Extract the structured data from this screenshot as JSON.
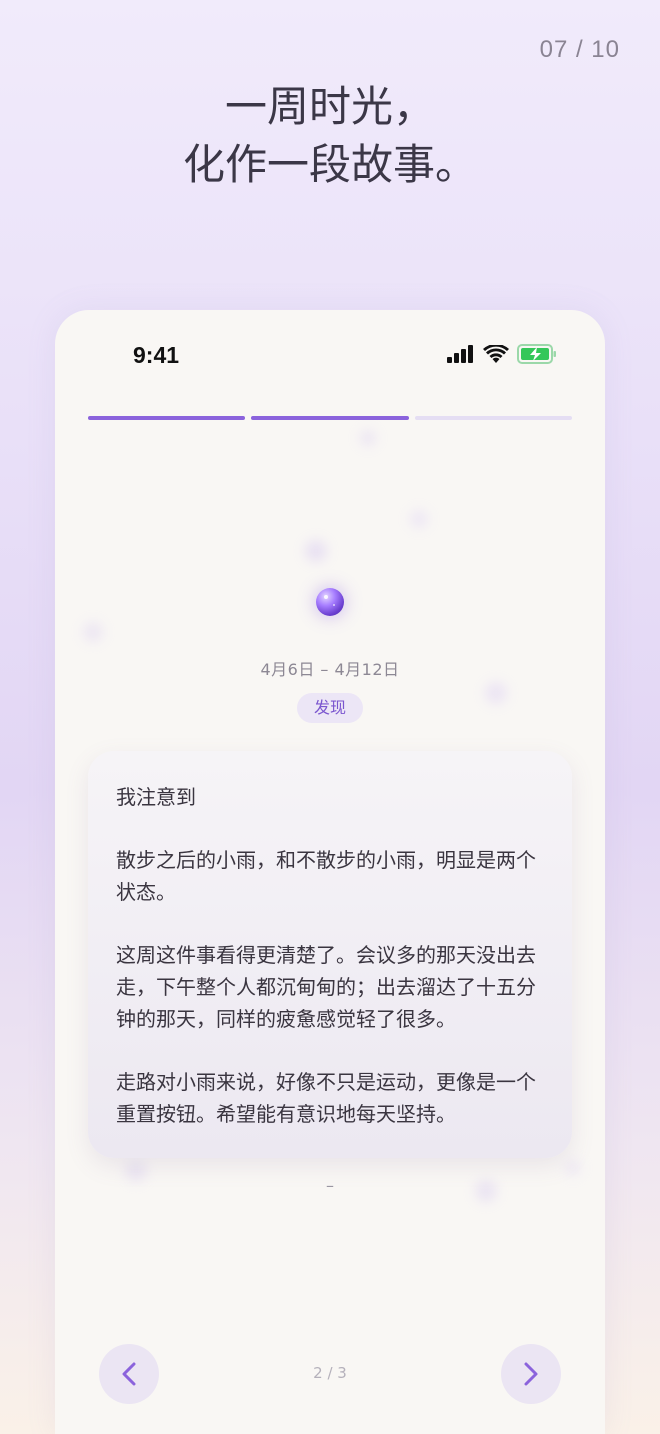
{
  "page_counter": "07 / 10",
  "headline": {
    "line1": "一周时光，",
    "line2": "化作一段故事。"
  },
  "phone": {
    "status_bar": {
      "time": "9:41",
      "icons": [
        "signal-icon",
        "wifi-icon",
        "battery-charging-icon"
      ]
    },
    "progress": {
      "total": 3,
      "active": 2
    },
    "orb_icon": "sparkle-orb-icon",
    "date_range": "4月6日 – 4月12日",
    "tag": "发现",
    "story": {
      "paragraphs": [
        "我注意到",
        "散步之后的小雨，和不散步的小雨，明显是两个状态。",
        "这周这件事看得更清楚了。会议多的那天没出去走，下午整个人都沉甸甸的；出去溜达了十五分钟的那天，同样的疲惫感觉轻了很多。",
        "走路对小雨来说，好像不只是运动，更像是一个重置按钮。希望能有意识地每天坚持。"
      ]
    },
    "divider_text": "–",
    "pager": "2 / 3",
    "nav": {
      "prev_icon": "chevron-left-icon",
      "next_icon": "chevron-right-icon"
    }
  },
  "colors": {
    "accent": "#8b63dc",
    "tag_text": "#7b56cf",
    "battery_green": "#34c759"
  }
}
